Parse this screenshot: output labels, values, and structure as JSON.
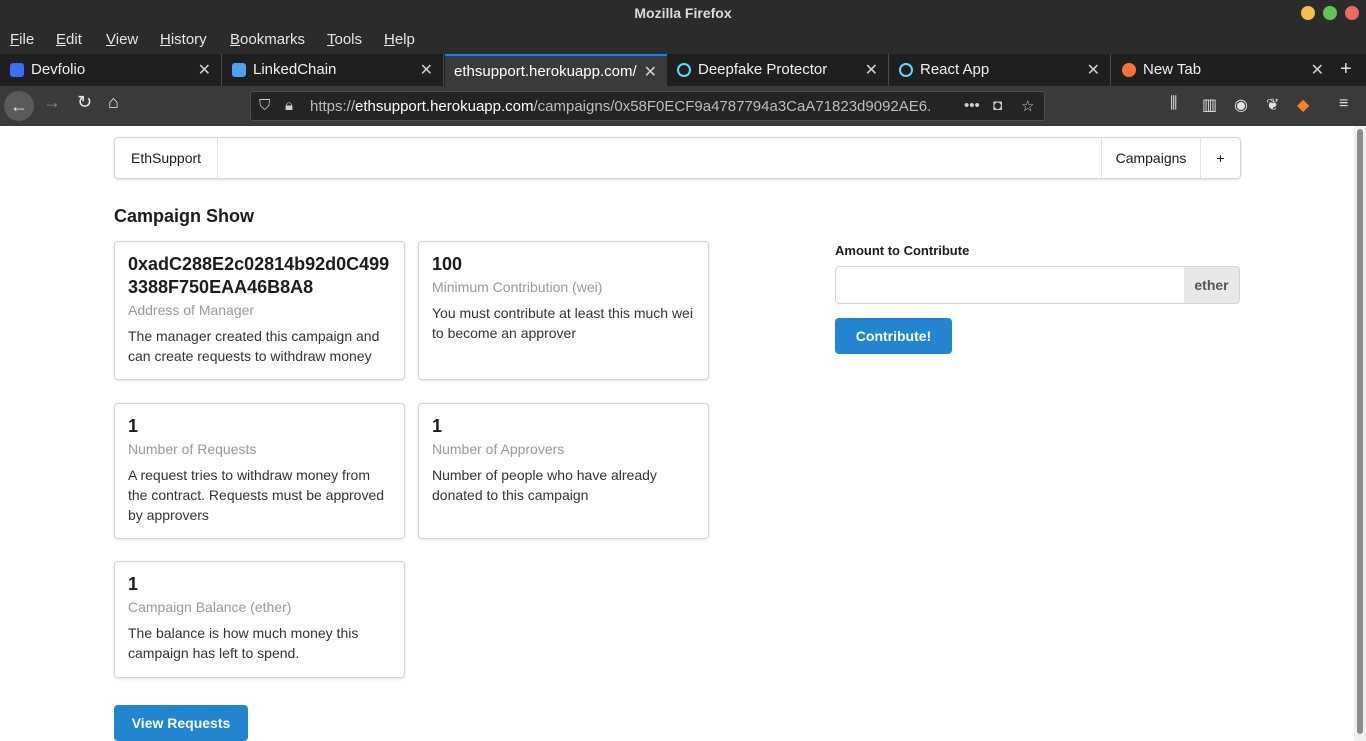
{
  "window": {
    "title": "Mozilla Firefox"
  },
  "menu": [
    "File",
    "Edit",
    "View",
    "History",
    "Bookmarks",
    "Tools",
    "Help"
  ],
  "tabs": [
    {
      "label": "Devfolio",
      "color": "#3770ff"
    },
    {
      "label": "LinkedChain",
      "color": "#4aa3f0"
    },
    {
      "label": "ethsupport.herokuapp.com/",
      "color": ""
    },
    {
      "label": "Deepfake Protector",
      "color": "#61dafb"
    },
    {
      "label": "React App",
      "color": "#61dafb"
    },
    {
      "label": "New Tab",
      "color": "#ff7139"
    }
  ],
  "url": {
    "prefix": "https://",
    "domain": "ethsupport.herokuapp.com",
    "path": "/campaigns/0x58F0ECF9a4787794a3CaA71823d9092AE6..."
  },
  "nav": {
    "brand": "EthSupport",
    "campaigns": "Campaigns",
    "plus": "+"
  },
  "page": {
    "title": "Campaign Show"
  },
  "cards": [
    {
      "header": "0xadC288E2c02814b92d0C4993388F750EAA46B8A8",
      "meta": "Address of Manager",
      "desc": "The manager created this campaign and can create requests to withdraw money"
    },
    {
      "header": "100",
      "meta": "Minimum Contribution (wei)",
      "desc": "You must contribute at least this much wei to become an approver"
    },
    {
      "header": "1",
      "meta": "Number of Requests",
      "desc": "A request tries to withdraw money from the contract. Requests must be approved by approvers"
    },
    {
      "header": "1",
      "meta": "Number of Approvers",
      "desc": "Number of people who have already donated to this campaign"
    },
    {
      "header": "1",
      "meta": "Campaign Balance (ether)",
      "desc": "The balance is how much money this campaign has left to spend."
    }
  ],
  "contribute": {
    "label": "Amount to Contribute",
    "value": "",
    "unit": "ether",
    "button": "Contribute!"
  },
  "view_requests": "View Requests"
}
